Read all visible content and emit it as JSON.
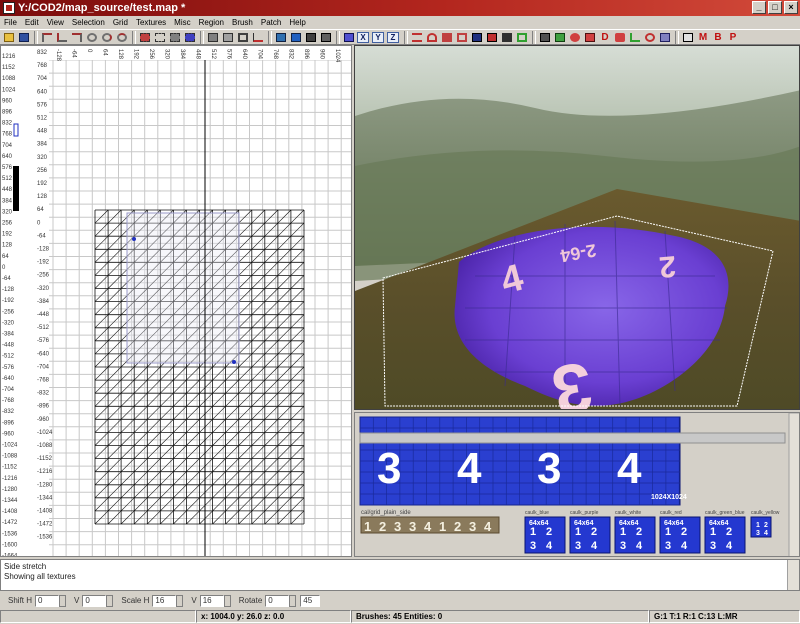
{
  "window": {
    "title": "Y:/COD2/map_source/test.map *",
    "minimize": "_",
    "maximize": "□",
    "close": "×"
  },
  "menu": [
    "File",
    "Edit",
    "View",
    "Selection",
    "Grid",
    "Textures",
    "Misc",
    "Region",
    "Brush",
    "Patch",
    "Help"
  ],
  "toolbar": {
    "letter_buttons": [
      "X",
      "Y",
      "Z"
    ],
    "right_letters": [
      "M",
      "B",
      "P"
    ],
    "accent": "#c01010"
  },
  "grid_view": {
    "x_ruler": [
      "-128",
      "-64",
      "0",
      "64",
      "128",
      "192",
      "256",
      "320",
      "384",
      "448",
      "512",
      "576",
      "640",
      "704",
      "768",
      "832",
      "896",
      "960",
      "1024"
    ],
    "y_ruler": [
      "1216",
      "1152",
      "1088",
      "1024",
      "960",
      "896",
      "832",
      "768",
      "704",
      "640",
      "576",
      "512",
      "448",
      "384",
      "320",
      "256",
      "192",
      "128",
      "64",
      "0",
      "-64",
      "-128",
      "-192",
      "-256",
      "-320",
      "-384",
      "-448",
      "-512",
      "-576",
      "-640",
      "-704",
      "-768",
      "-832",
      "-896",
      "-960",
      "-1024",
      "-1088",
      "-1152",
      "-1216",
      "-1280",
      "-1344",
      "-1408",
      "-1472",
      "-1536",
      "-1600",
      "-1664"
    ],
    "inner_y_ruler": [
      "832",
      "768",
      "704",
      "640",
      "576",
      "512",
      "448",
      "384",
      "320",
      "256",
      "192",
      "128",
      "64",
      "0",
      "-64",
      "-128",
      "-192",
      "-256",
      "-320",
      "-384",
      "-448",
      "-512",
      "-576",
      "-640",
      "-704",
      "-768",
      "-832",
      "-896",
      "-960",
      "-1024",
      "-1088",
      "-1152",
      "-1216",
      "-1280",
      "-1344",
      "-1408",
      "-1472",
      "-1536"
    ]
  },
  "texture_browser": {
    "main_texture_size": "1024X1024",
    "main_digits": [
      "3",
      "4",
      "3",
      "4"
    ],
    "strip_label": "cal/grid_plain_side",
    "strip_digits": [
      "1",
      "2",
      "3",
      "3",
      "4",
      "1",
      "2",
      "3",
      "4"
    ],
    "tiles": [
      {
        "name": "caulk_blue",
        "size": "64x64",
        "digits": [
          "1",
          "2",
          "3",
          "4"
        ]
      },
      {
        "name": "caulk_purple",
        "size": "64x64",
        "digits": [
          "1",
          "2",
          "3",
          "4"
        ]
      },
      {
        "name": "caulk_white",
        "size": "64x64",
        "digits": [
          "1",
          "2",
          "3",
          "4"
        ]
      },
      {
        "name": "caulk_red",
        "size": "64x64",
        "digits": [
          "1",
          "2",
          "3",
          "4"
        ]
      },
      {
        "name": "caulk_green_blue",
        "size": "64x64",
        "digits": [
          "1",
          "2",
          "3",
          "4"
        ]
      },
      {
        "name": "caulk_yellow",
        "size": "",
        "digits": [
          "1",
          "2",
          "3",
          "4"
        ]
      }
    ]
  },
  "console": {
    "lines": [
      "Side stretch",
      "Showing all textures"
    ]
  },
  "surface": {
    "shift_h_label": "Shift H",
    "shift_h": "0",
    "shift_v_label": "V",
    "shift_v": "0",
    "scale_h_label": "Scale H",
    "scale_h": "16",
    "scale_v_label": "V",
    "scale_v": "16",
    "rotate_label": "Rotate",
    "rotate": "0",
    "rotate_step": "45"
  },
  "status": {
    "coords": "x: 1004.0  y: 26.0  z: 0.0",
    "brushes": "Brushes: 45 Entities: 0",
    "grid": "G:1 T:1 R:1 C:13 L:MR"
  }
}
